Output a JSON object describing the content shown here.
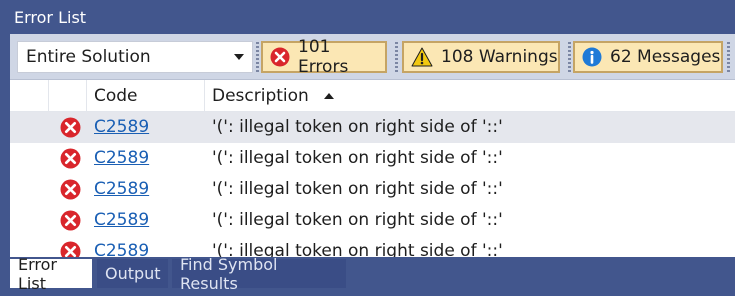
{
  "window": {
    "title": "Error List"
  },
  "toolbar": {
    "scope": "Entire Solution",
    "errors_label": "101 Errors",
    "warnings_label": "108 Warnings",
    "messages_label": "62 Messages"
  },
  "columns": {
    "code": "Code",
    "description": "Description"
  },
  "rows": [
    {
      "code": "C2589",
      "description": "'(': illegal token on right side of '::'"
    },
    {
      "code": "C2589",
      "description": "'(': illegal token on right side of '::'"
    },
    {
      "code": "C2589",
      "description": "'(': illegal token on right side of '::'"
    },
    {
      "code": "C2589",
      "description": "'(': illegal token on right side of '::'"
    },
    {
      "code": "C2589",
      "description": "'(': illegal token on right side of '::'"
    }
  ],
  "tabs": [
    {
      "label": "Error List"
    },
    {
      "label": "Output"
    },
    {
      "label": "Find Symbol Results"
    }
  ],
  "colors": {
    "chrome": "#42568d",
    "error": "#d9262c",
    "warning": "#f2c811",
    "info": "#1f7ad7",
    "link": "#1a5fb4"
  },
  "icons": [
    "error-icon",
    "warning-icon",
    "info-icon",
    "sort-ascending-icon",
    "dropdown-arrow-icon"
  ]
}
